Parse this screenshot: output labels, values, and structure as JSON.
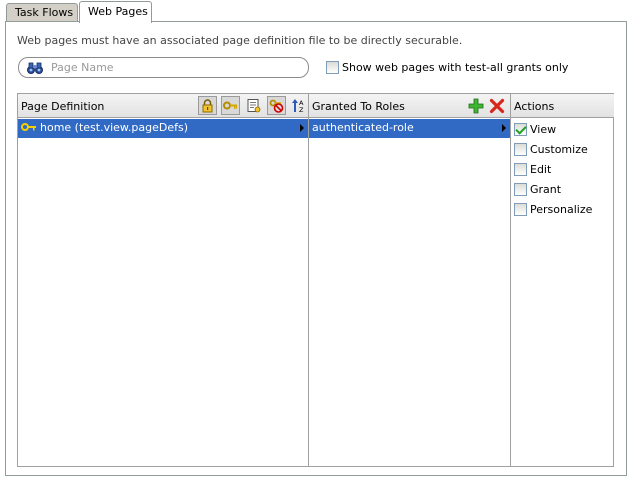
{
  "tabs": [
    {
      "label": "Task Flows"
    },
    {
      "label": "Web Pages"
    }
  ],
  "info_text": "Web pages must have an associated page definition file to be directly securable.",
  "search": {
    "placeholder": "Page Name",
    "value": ""
  },
  "show_test_all": {
    "label": "Show web pages with test-all grants only",
    "checked": false
  },
  "page_definition": {
    "header": "Page Definition",
    "toolbar_icons": [
      "lock-icon",
      "key-icon",
      "page-properties-icon",
      "remove-grant-icon",
      "sort-icon"
    ],
    "rows": [
      {
        "label": "home (test.view.pageDefs)",
        "selected": true
      }
    ]
  },
  "granted_roles": {
    "header": "Granted To Roles",
    "toolbar_icons": [
      "add-icon",
      "delete-icon"
    ],
    "rows": [
      {
        "label": "authenticated-role",
        "selected": true
      }
    ]
  },
  "actions": {
    "header": "Actions",
    "items": [
      {
        "label": "View",
        "checked": true
      },
      {
        "label": "Customize",
        "checked": false
      },
      {
        "label": "Edit",
        "checked": false
      },
      {
        "label": "Grant",
        "checked": false
      },
      {
        "label": "Personalize",
        "checked": false
      }
    ]
  },
  "colors": {
    "selection": "#316ac5",
    "header_bg": "#e8e8e8",
    "border": "#a0a0a0"
  }
}
